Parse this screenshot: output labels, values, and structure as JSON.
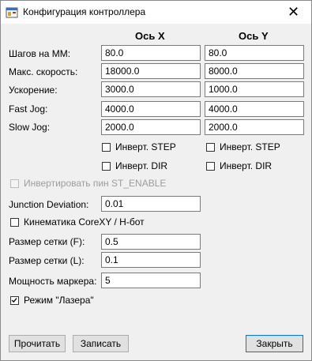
{
  "window": {
    "title": "Конфигурация контроллера",
    "close_glyph": "✕"
  },
  "headers": {
    "x": "Ось X",
    "y": "Ось Y"
  },
  "rows": [
    {
      "label": "Шагов на ММ:",
      "x": "80.0",
      "y": "80.0"
    },
    {
      "label": "Макс. скорость:",
      "x": "18000.0",
      "y": "8000.0"
    },
    {
      "label": "Ускорение:",
      "x": "3000.0",
      "y": "1000.0"
    },
    {
      "label": "Fast Jog:",
      "x": "4000.0",
      "y": "4000.0"
    },
    {
      "label": "Slow Jog:",
      "x": "2000.0",
      "y": "2000.0"
    }
  ],
  "checks": {
    "invert_step_x": {
      "label": "Инверт. STEP",
      "checked": false
    },
    "invert_step_y": {
      "label": "Инверт. STEP",
      "checked": false
    },
    "invert_dir_x": {
      "label": "Инверт. DIR",
      "checked": false
    },
    "invert_dir_y": {
      "label": "Инверт. DIR",
      "checked": false
    },
    "invert_enable": {
      "label": "Инвертировать пин ST_ENABLE",
      "checked": false,
      "disabled": true
    },
    "corexy": {
      "label": "Кинематика CoreXY / H-бот",
      "checked": false
    },
    "laser": {
      "label": "Режим \"Лазера\"",
      "checked": true
    }
  },
  "junction": {
    "label": "Junction Deviation:",
    "value": "0.01"
  },
  "grid_f": {
    "label": "Размер сетки (F):",
    "value": "0.5"
  },
  "grid_l": {
    "label": "Размер сетки (L):",
    "value": "0.1"
  },
  "marker": {
    "label": "Мощность маркера:",
    "value": "5"
  },
  "buttons": {
    "read": "Прочитать",
    "write": "Записать",
    "close": "Закрыть"
  }
}
